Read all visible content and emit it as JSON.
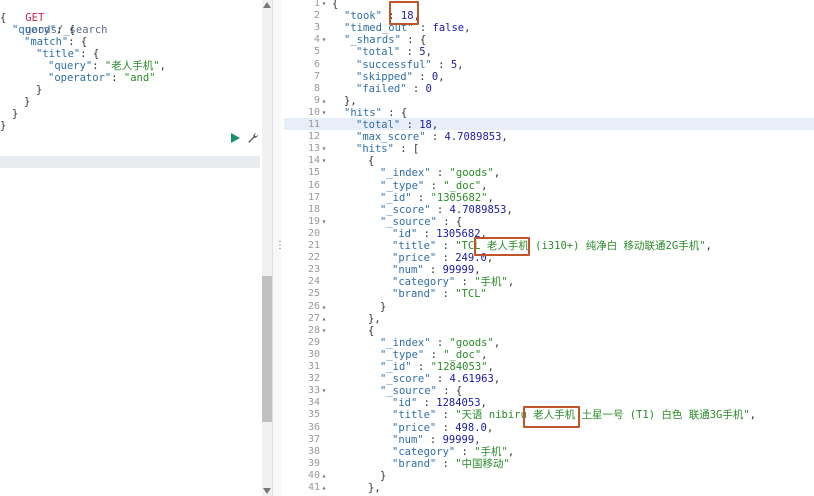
{
  "request": {
    "method": "GET",
    "path": "goods/_search",
    "lines": [
      {
        "indent": 0,
        "parts": [
          [
            "p",
            "{"
          ]
        ]
      },
      {
        "indent": 1,
        "parts": [
          [
            "k",
            "\"query\""
          ],
          [
            "p",
            ": {"
          ]
        ]
      },
      {
        "indent": 2,
        "parts": [
          [
            "k",
            "\"match\""
          ],
          [
            "p",
            ": {"
          ]
        ]
      },
      {
        "indent": 3,
        "parts": [
          [
            "k",
            "\"title\""
          ],
          [
            "p",
            ": {"
          ]
        ]
      },
      {
        "indent": 4,
        "parts": [
          [
            "k",
            "\"query\""
          ],
          [
            "p",
            ": "
          ],
          [
            "s",
            "\"老人手机\""
          ],
          [
            "p",
            ","
          ]
        ]
      },
      {
        "indent": 4,
        "parts": [
          [
            "k",
            "\"operator\""
          ],
          [
            "p",
            ": "
          ],
          [
            "s",
            "\"and\""
          ]
        ]
      },
      {
        "indent": 3,
        "parts": [
          [
            "p",
            "}"
          ]
        ]
      },
      {
        "indent": 2,
        "parts": [
          [
            "p",
            "}"
          ]
        ]
      },
      {
        "indent": 1,
        "parts": [
          [
            "p",
            "}"
          ]
        ]
      },
      {
        "indent": 0,
        "parts": [
          [
            "p",
            "}"
          ]
        ]
      }
    ]
  },
  "response": {
    "lines": [
      {
        "n": "1",
        "fold": "▾",
        "indent": 0,
        "parts": [
          [
            "p",
            "{"
          ]
        ]
      },
      {
        "n": "2",
        "fold": "",
        "indent": 1,
        "parts": [
          [
            "k",
            "\"took\""
          ],
          [
            "p",
            " : "
          ],
          [
            "n",
            "18"
          ],
          [
            "p",
            ","
          ]
        ]
      },
      {
        "n": "3",
        "fold": "",
        "indent": 1,
        "parts": [
          [
            "k",
            "\"timed_out\""
          ],
          [
            "p",
            " : "
          ],
          [
            "b",
            "false"
          ],
          [
            "p",
            ","
          ]
        ]
      },
      {
        "n": "4",
        "fold": "▾",
        "indent": 1,
        "parts": [
          [
            "k",
            "\"_shards\""
          ],
          [
            "p",
            " : {"
          ]
        ]
      },
      {
        "n": "5",
        "fold": "",
        "indent": 2,
        "parts": [
          [
            "k",
            "\"total\""
          ],
          [
            "p",
            " : "
          ],
          [
            "n",
            "5"
          ],
          [
            "p",
            ","
          ]
        ]
      },
      {
        "n": "6",
        "fold": "",
        "indent": 2,
        "parts": [
          [
            "k",
            "\"successful\""
          ],
          [
            "p",
            " : "
          ],
          [
            "n",
            "5"
          ],
          [
            "p",
            ","
          ]
        ]
      },
      {
        "n": "7",
        "fold": "",
        "indent": 2,
        "parts": [
          [
            "k",
            "\"skipped\""
          ],
          [
            "p",
            " : "
          ],
          [
            "n",
            "0"
          ],
          [
            "p",
            ","
          ]
        ]
      },
      {
        "n": "8",
        "fold": "",
        "indent": 2,
        "parts": [
          [
            "k",
            "\"failed\""
          ],
          [
            "p",
            " : "
          ],
          [
            "n",
            "0"
          ]
        ]
      },
      {
        "n": "9",
        "fold": "▴",
        "indent": 1,
        "parts": [
          [
            "p",
            "},"
          ]
        ]
      },
      {
        "n": "10",
        "fold": "▾",
        "indent": 1,
        "parts": [
          [
            "k",
            "\"hits\""
          ],
          [
            "p",
            " : {"
          ]
        ]
      },
      {
        "n": "11",
        "fold": "",
        "indent": 2,
        "parts": [
          [
            "k",
            "\"total\""
          ],
          [
            "p",
            " : "
          ],
          [
            "n",
            "18"
          ],
          [
            "p",
            ","
          ]
        ]
      },
      {
        "n": "12",
        "fold": "",
        "indent": 2,
        "parts": [
          [
            "k",
            "\"max_score\""
          ],
          [
            "p",
            " : "
          ],
          [
            "n",
            "4.7089853"
          ],
          [
            "p",
            ","
          ]
        ]
      },
      {
        "n": "13",
        "fold": "▾",
        "indent": 2,
        "parts": [
          [
            "k",
            "\"hits\""
          ],
          [
            "p",
            " : ["
          ]
        ]
      },
      {
        "n": "14",
        "fold": "▾",
        "indent": 3,
        "parts": [
          [
            "p",
            "{"
          ]
        ]
      },
      {
        "n": "15",
        "fold": "",
        "indent": 4,
        "parts": [
          [
            "k",
            "\"_index\""
          ],
          [
            "p",
            " : "
          ],
          [
            "s",
            "\"goods\""
          ],
          [
            "p",
            ","
          ]
        ]
      },
      {
        "n": "16",
        "fold": "",
        "indent": 4,
        "parts": [
          [
            "k",
            "\"_type\""
          ],
          [
            "p",
            " : "
          ],
          [
            "s",
            "\"_doc\""
          ],
          [
            "p",
            ","
          ]
        ]
      },
      {
        "n": "17",
        "fold": "",
        "indent": 4,
        "parts": [
          [
            "k",
            "\"_id\""
          ],
          [
            "p",
            " : "
          ],
          [
            "s",
            "\"1305682\""
          ],
          [
            "p",
            ","
          ]
        ]
      },
      {
        "n": "18",
        "fold": "",
        "indent": 4,
        "parts": [
          [
            "k",
            "\"_score\""
          ],
          [
            "p",
            " : "
          ],
          [
            "n",
            "4.7089853"
          ],
          [
            "p",
            ","
          ]
        ]
      },
      {
        "n": "19",
        "fold": "▾",
        "indent": 4,
        "parts": [
          [
            "k",
            "\"_source\""
          ],
          [
            "p",
            " : {"
          ]
        ]
      },
      {
        "n": "20",
        "fold": "",
        "indent": 5,
        "parts": [
          [
            "k",
            "\"id\""
          ],
          [
            "p",
            " : "
          ],
          [
            "n",
            "1305682"
          ],
          [
            "p",
            ","
          ]
        ]
      },
      {
        "n": "21",
        "fold": "",
        "indent": 5,
        "parts": [
          [
            "k",
            "\"title\""
          ],
          [
            "p",
            " : "
          ],
          [
            "s",
            "\"TCL 老人手机 (i310+) 纯净白 移动联通2G手机\""
          ],
          [
            "p",
            ","
          ]
        ]
      },
      {
        "n": "22",
        "fold": "",
        "indent": 5,
        "parts": [
          [
            "k",
            "\"price\""
          ],
          [
            "p",
            " : "
          ],
          [
            "n",
            "249.0"
          ],
          [
            "p",
            ","
          ]
        ]
      },
      {
        "n": "23",
        "fold": "",
        "indent": 5,
        "parts": [
          [
            "k",
            "\"num\""
          ],
          [
            "p",
            " : "
          ],
          [
            "n",
            "99999"
          ],
          [
            "p",
            ","
          ]
        ]
      },
      {
        "n": "24",
        "fold": "",
        "indent": 5,
        "parts": [
          [
            "k",
            "\"category\""
          ],
          [
            "p",
            " : "
          ],
          [
            "s",
            "\"手机\""
          ],
          [
            "p",
            ","
          ]
        ]
      },
      {
        "n": "25",
        "fold": "",
        "indent": 5,
        "parts": [
          [
            "k",
            "\"brand\""
          ],
          [
            "p",
            " : "
          ],
          [
            "s",
            "\"TCL\""
          ]
        ]
      },
      {
        "n": "26",
        "fold": "▴",
        "indent": 4,
        "parts": [
          [
            "p",
            "}"
          ]
        ]
      },
      {
        "n": "27",
        "fold": "▴",
        "indent": 3,
        "parts": [
          [
            "p",
            "},"
          ]
        ]
      },
      {
        "n": "28",
        "fold": "▾",
        "indent": 3,
        "parts": [
          [
            "p",
            "{"
          ]
        ]
      },
      {
        "n": "29",
        "fold": "",
        "indent": 4,
        "parts": [
          [
            "k",
            "\"_index\""
          ],
          [
            "p",
            " : "
          ],
          [
            "s",
            "\"goods\""
          ],
          [
            "p",
            ","
          ]
        ]
      },
      {
        "n": "30",
        "fold": "",
        "indent": 4,
        "parts": [
          [
            "k",
            "\"_type\""
          ],
          [
            "p",
            " : "
          ],
          [
            "s",
            "\"_doc\""
          ],
          [
            "p",
            ","
          ]
        ]
      },
      {
        "n": "31",
        "fold": "",
        "indent": 4,
        "parts": [
          [
            "k",
            "\"_id\""
          ],
          [
            "p",
            " : "
          ],
          [
            "s",
            "\"1284053\""
          ],
          [
            "p",
            ","
          ]
        ]
      },
      {
        "n": "32",
        "fold": "",
        "indent": 4,
        "parts": [
          [
            "k",
            "\"_score\""
          ],
          [
            "p",
            " : "
          ],
          [
            "n",
            "4.61963"
          ],
          [
            "p",
            ","
          ]
        ]
      },
      {
        "n": "33",
        "fold": "▾",
        "indent": 4,
        "parts": [
          [
            "k",
            "\"_source\""
          ],
          [
            "p",
            " : {"
          ]
        ]
      },
      {
        "n": "34",
        "fold": "",
        "indent": 5,
        "parts": [
          [
            "k",
            "\"id\""
          ],
          [
            "p",
            " : "
          ],
          [
            "n",
            "1284053"
          ],
          [
            "p",
            ","
          ]
        ]
      },
      {
        "n": "35",
        "fold": "",
        "indent": 5,
        "parts": [
          [
            "k",
            "\"title\""
          ],
          [
            "p",
            " : "
          ],
          [
            "s",
            "\"天语 nibiru 老人手机 土星一号 (T1) 白色 联通3G手机\""
          ],
          [
            "p",
            ","
          ]
        ]
      },
      {
        "n": "36",
        "fold": "",
        "indent": 5,
        "parts": [
          [
            "k",
            "\"price\""
          ],
          [
            "p",
            " : "
          ],
          [
            "n",
            "498.0"
          ],
          [
            "p",
            ","
          ]
        ]
      },
      {
        "n": "37",
        "fold": "",
        "indent": 5,
        "parts": [
          [
            "k",
            "\"num\""
          ],
          [
            "p",
            " : "
          ],
          [
            "n",
            "99999"
          ],
          [
            "p",
            ","
          ]
        ]
      },
      {
        "n": "38",
        "fold": "",
        "indent": 5,
        "parts": [
          [
            "k",
            "\"category\""
          ],
          [
            "p",
            " : "
          ],
          [
            "s",
            "\"手机\""
          ],
          [
            "p",
            ","
          ]
        ]
      },
      {
        "n": "39",
        "fold": "",
        "indent": 5,
        "parts": [
          [
            "k",
            "\"brand\""
          ],
          [
            "p",
            " : "
          ],
          [
            "s",
            "\"中国移动\""
          ]
        ]
      },
      {
        "n": "40",
        "fold": "▴",
        "indent": 4,
        "parts": [
          [
            "p",
            "}"
          ]
        ]
      },
      {
        "n": "41",
        "fold": "▴",
        "indent": 3,
        "parts": [
          [
            "p",
            "},"
          ]
        ]
      }
    ]
  },
  "icons": {
    "run": "play-icon",
    "settings": "wrench-icon",
    "grip": "splitter-grip-icon"
  },
  "colors": {
    "highlight_box": "#c0552a",
    "run_button": "#1e8f6e",
    "active_line": "#e8eef7"
  }
}
